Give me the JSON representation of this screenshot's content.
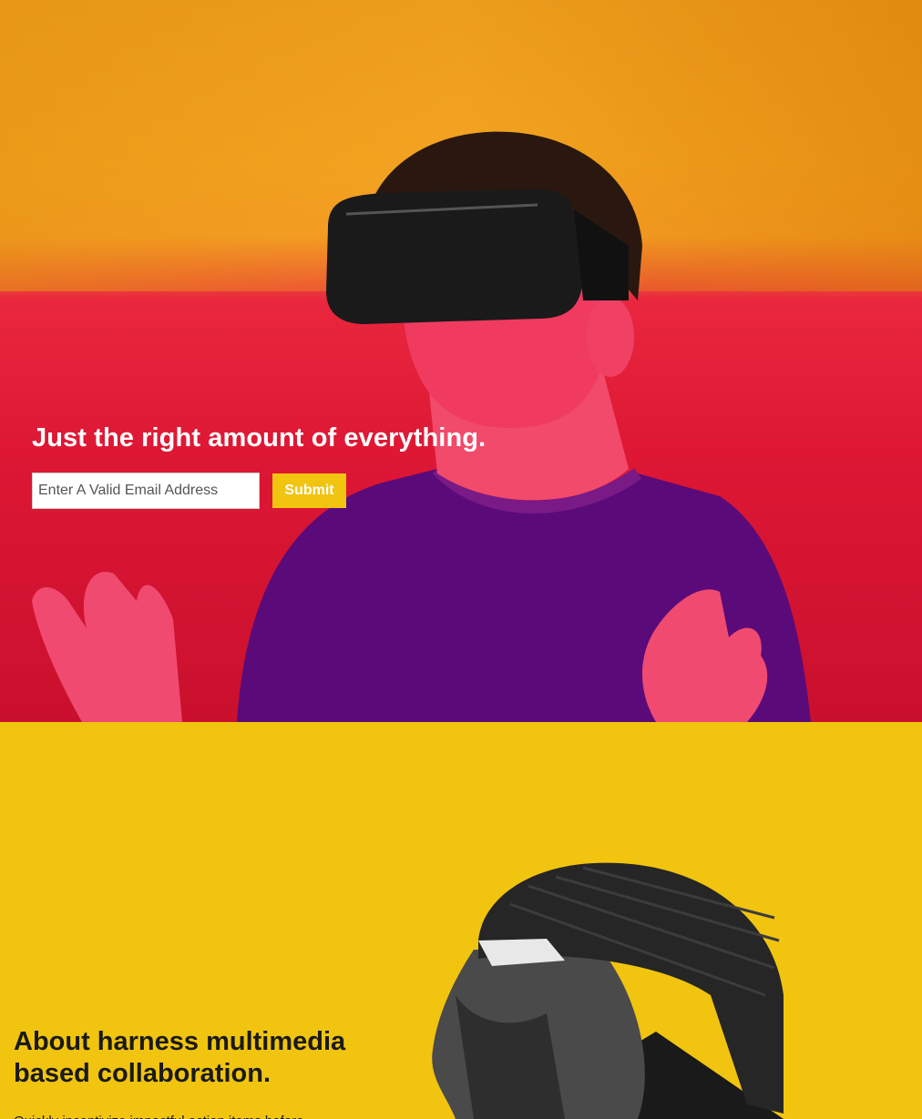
{
  "hero": {
    "title": "Just the right amount of everything.",
    "email_placeholder": "Enter A Valid Email Address",
    "submit_label": "Submit",
    "image": "person-wearing-vr-headset-photo"
  },
  "about": {
    "title": "About harness multimedia based collaboration.",
    "text": "Quickly incentivize impactful action items before",
    "image": "man-in-backwards-cap-profile-photo"
  },
  "colors": {
    "accent": "#f1c40f",
    "hero_top": "#f2a21f",
    "hero_bottom": "#dd1734",
    "shirt": "#5a0a78"
  }
}
